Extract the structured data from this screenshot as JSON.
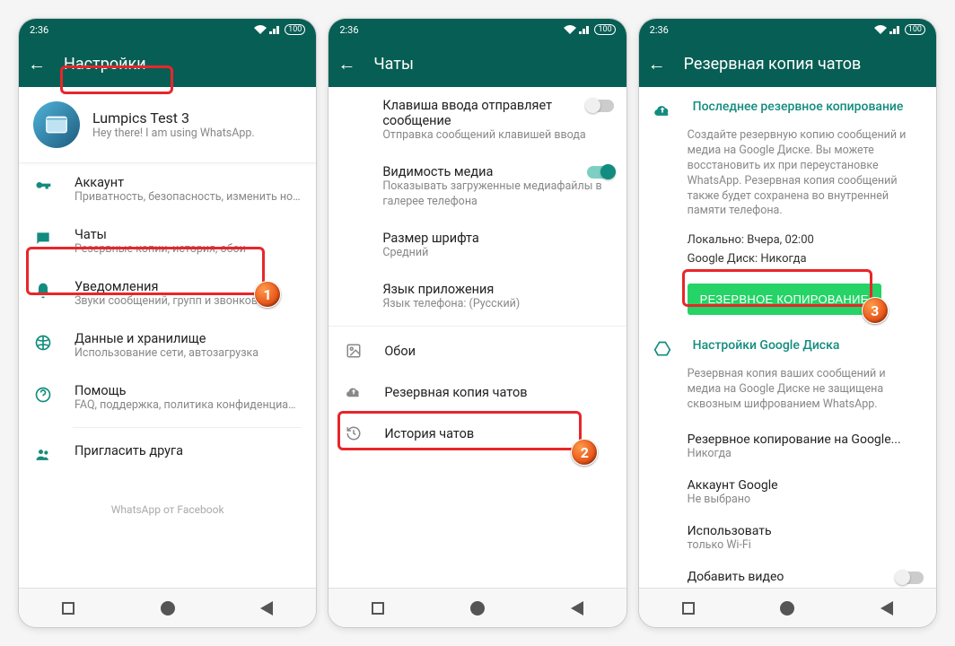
{
  "status": {
    "time": "2:36",
    "battery": "100"
  },
  "screen1": {
    "title": "Настройки",
    "profile": {
      "name": "Lumpics Test 3",
      "status": "Hey there! I am using WhatsApp."
    },
    "items": [
      {
        "primary": "Аккаунт",
        "secondary": "Приватность, безопасность, изменить номер"
      },
      {
        "primary": "Чаты",
        "secondary": "Резервные копии, история, обои"
      },
      {
        "primary": "Уведомления",
        "secondary": "Звуки сообщений, групп и звонков"
      },
      {
        "primary": "Данные и хранилище",
        "secondary": "Использование сети, автозагрузка"
      },
      {
        "primary": "Помощь",
        "secondary": "FAQ, поддержка, политика конфиденциаль..."
      },
      {
        "primary": "Пригласить друга",
        "secondary": ""
      }
    ],
    "footer": "WhatsApp от Facebook"
  },
  "screen2": {
    "title": "Чаты",
    "settings": [
      {
        "primary": "Клавиша ввода отправляет сообщение",
        "secondary": "Отправка сообщений клавишей ввода"
      },
      {
        "primary": "Видимость медиа",
        "secondary": "Показывать загруженные медиафайлы в галерее телефона"
      },
      {
        "primary": "Размер шрифта",
        "secondary": "Средний"
      },
      {
        "primary": "Язык приложения",
        "secondary": "Язык телефона: (Русский)"
      }
    ],
    "rows": [
      {
        "label": "Обои"
      },
      {
        "label": "Резервная копия чатов"
      },
      {
        "label": "История чатов"
      }
    ]
  },
  "screen3": {
    "title": "Резервная копия чатов",
    "last": {
      "heading": "Последнее резервное копирование",
      "desc": "Создайте резервную копию сообщений и медиа на Google Диске. Вы можете восстановить их при переустановке WhatsApp. Резервная копия сообщений также будет сохранена во внутренней памяти телефона.",
      "local": "Локально: Вчера, 02:00",
      "drive": "Google Диск: Никогда"
    },
    "button": "РЕЗЕРВНОЕ КОПИРОВАНИЕ",
    "gd": {
      "heading": "Настройки Google Диска",
      "desc": "Резервная копия ваших сообщений и медиа на Google Диске не защищена сквозным шифрованием WhatsApp."
    },
    "subs": [
      {
        "primary": "Резервное копирование на Google...",
        "secondary": "Никогда"
      },
      {
        "primary": "Аккаунт Google",
        "secondary": "Не выбрано"
      },
      {
        "primary": "Использовать",
        "secondary": "только Wi-Fi"
      },
      {
        "primary": "Добавить видео",
        "secondary": ""
      }
    ]
  },
  "badges": {
    "b1": "1",
    "b2": "2",
    "b3": "3"
  }
}
